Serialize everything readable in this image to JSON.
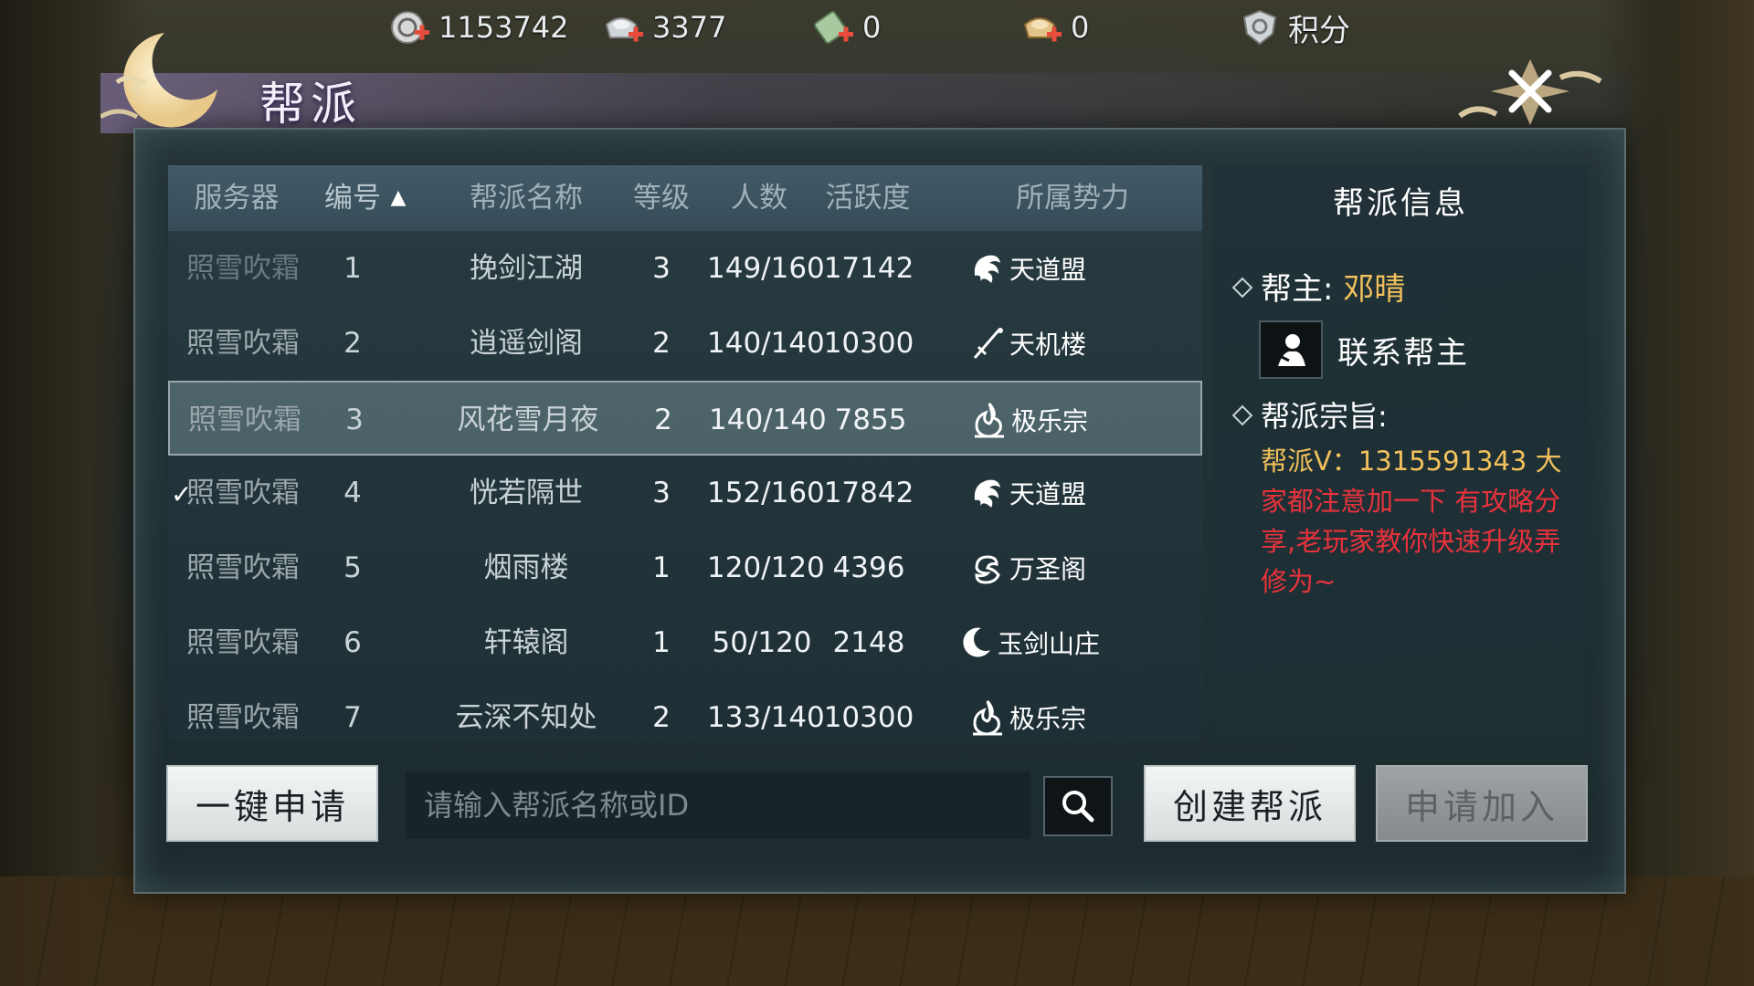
{
  "currency": [
    {
      "icon": "coin-plus-icon",
      "value": "1153742"
    },
    {
      "icon": "silver-ingot-plus-icon",
      "value": "3377"
    },
    {
      "icon": "jade-ticket-plus-icon",
      "value": "0"
    },
    {
      "icon": "gold-ingot-plus-icon",
      "value": "0"
    },
    {
      "icon": "shield-points-icon",
      "value": "积分"
    }
  ],
  "window": {
    "title": "帮派"
  },
  "table": {
    "headers": {
      "server": "服务器",
      "id": "编号",
      "name": "帮派名称",
      "level": "等级",
      "members": "人数",
      "activity": "活跃度",
      "faction": "所属势力"
    },
    "sort_indicator": "▲",
    "rows": [
      {
        "server": "照雪吹霜",
        "id": "1",
        "name": "挽剑江湖",
        "level": "3",
        "members": "149/160",
        "activity": "17142",
        "faction": "天道盟",
        "faction_icon": "dragon-emblem-icon"
      },
      {
        "server": "照雪吹霜",
        "id": "2",
        "name": "逍遥剑阁",
        "level": "2",
        "members": "140/140",
        "activity": "10300",
        "faction": "天机楼",
        "faction_icon": "sword-emblem-icon"
      },
      {
        "server": "照雪吹霜",
        "id": "3",
        "name": "风花雪月夜",
        "level": "2",
        "members": "140/140",
        "activity": "7855",
        "faction": "极乐宗",
        "faction_icon": "flame-emblem-icon"
      },
      {
        "server": "照雪吹霜",
        "id": "4",
        "name": "恍若隔世",
        "level": "3",
        "members": "152/160",
        "activity": "17842",
        "faction": "天道盟",
        "faction_icon": "dragon-emblem-icon"
      },
      {
        "server": "照雪吹霜",
        "id": "5",
        "name": "烟雨楼",
        "level": "1",
        "members": "120/120",
        "activity": "4396",
        "faction": "万圣阁",
        "faction_icon": "cloud-emblem-icon"
      },
      {
        "server": "照雪吹霜",
        "id": "6",
        "name": "轩辕阁",
        "level": "1",
        "members": "50/120",
        "activity": "2148",
        "faction": "玉剑山庄",
        "faction_icon": "moon-emblem-icon"
      },
      {
        "server": "照雪吹霜",
        "id": "7",
        "name": "云深不知处",
        "level": "2",
        "members": "133/140",
        "activity": "10300",
        "faction": "极乐宗",
        "faction_icon": "flame-emblem-icon"
      }
    ],
    "selected_row": "3",
    "checked_row": "4",
    "check_mark": "✓"
  },
  "info": {
    "header": "帮派信息",
    "leader_label": "帮主: ",
    "leader_name": "邓晴",
    "contact_label": "联系帮主",
    "motto_label": "帮派宗旨:",
    "motto_part1": "帮派V：1315591343 大",
    "motto_part2": "家都注意加一下 有攻略分享,老玩家教你快速升级弄修为~"
  },
  "controls": {
    "one_click_apply": "一键申请",
    "search_placeholder": "请输入帮派名称或ID",
    "create": "创建帮派",
    "apply_join": "申请加入"
  },
  "colors": {
    "leader_gold": "#f2c15c",
    "motto_red": "#e8323c"
  }
}
